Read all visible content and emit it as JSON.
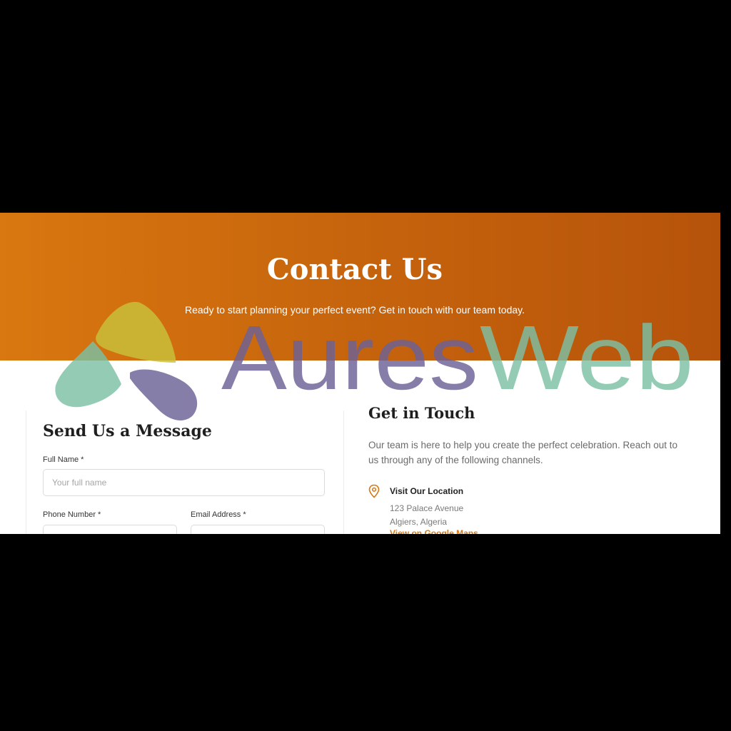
{
  "hero": {
    "title": "Contact Us",
    "subtitle": "Ready to start planning your perfect event? Get in touch with our team today."
  },
  "form": {
    "title": "Send Us a Message",
    "full_name": {
      "label": "Full Name *",
      "placeholder": "Your full name",
      "value": ""
    },
    "phone": {
      "label": "Phone Number *",
      "value": ""
    },
    "email": {
      "label": "Email Address *",
      "value": ""
    }
  },
  "contact": {
    "title": "Get in Touch",
    "description": "Our team is here to help you create the perfect celebration. Reach out to us through any of the following channels.",
    "location": {
      "icon": "map-pin-icon",
      "title": "Visit Our Location",
      "address_line1": "123 Palace Avenue",
      "address_line2": "Algiers, Algeria",
      "map_link": "View on Google Maps"
    }
  },
  "watermark": {
    "text_part1": "Aures",
    "text_part2": "Web"
  },
  "colors": {
    "page_background": "#000000",
    "hero_gradient_start": "#d97710",
    "hero_gradient_end": "#b6530b",
    "accent": "#d97710",
    "watermark_purple": "#6b6296",
    "watermark_green": "#7cc0a4",
    "watermark_yellow": "#c9c23a"
  }
}
